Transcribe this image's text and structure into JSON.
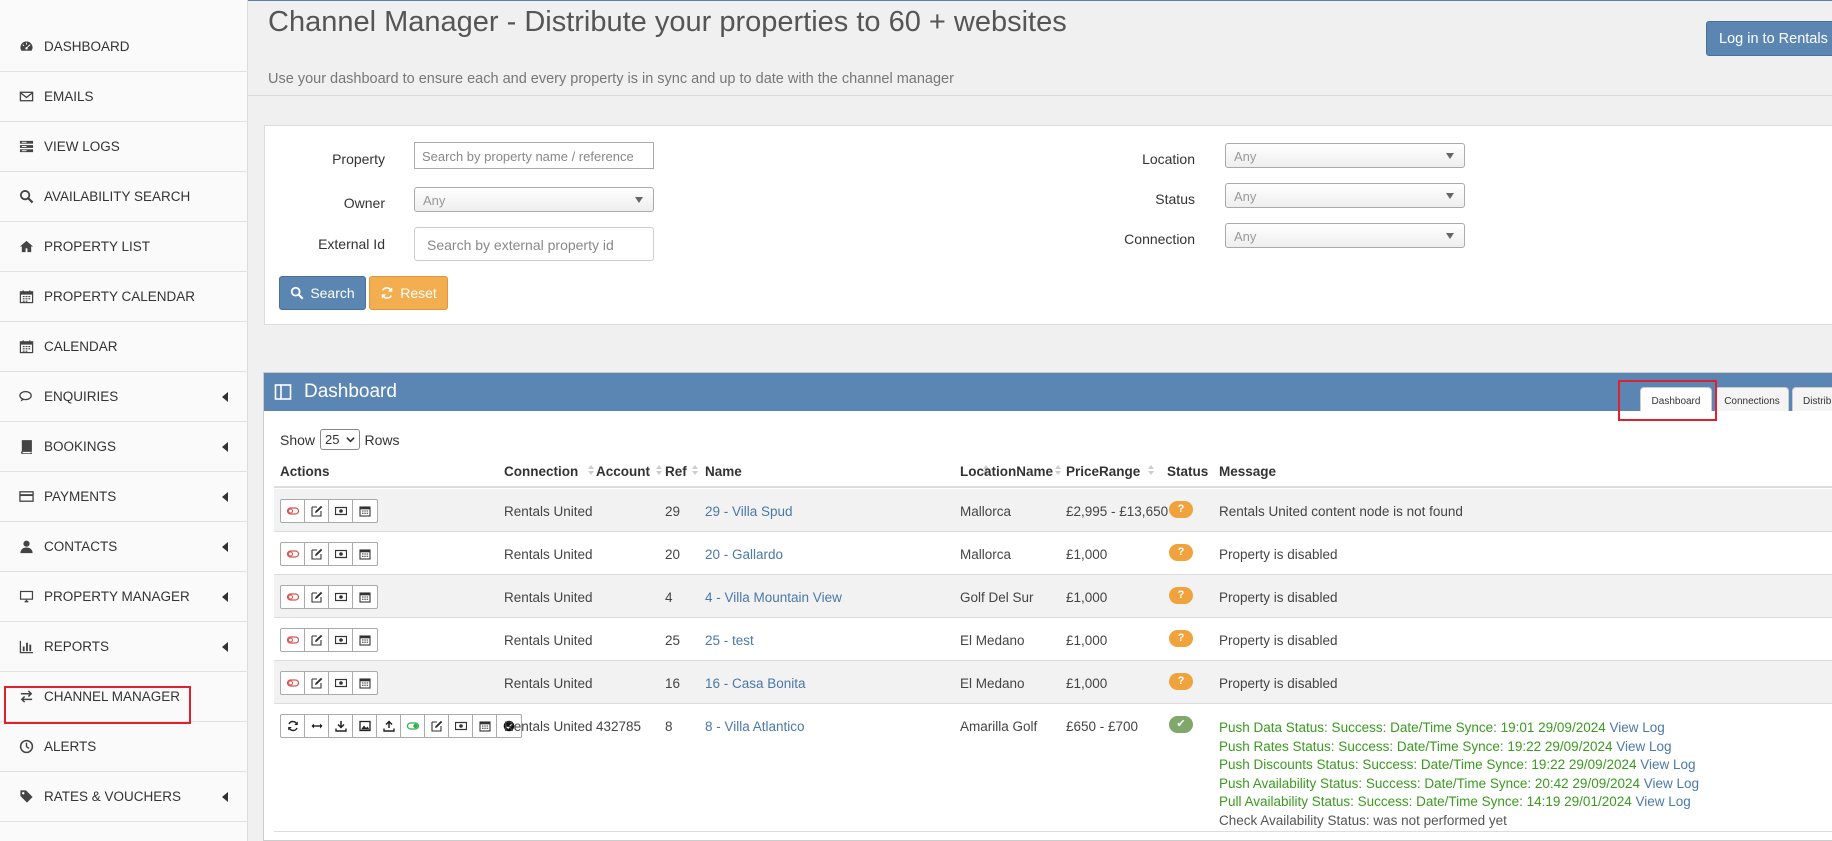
{
  "sidebar": {
    "items": [
      {
        "label": "DASHBOARD",
        "icon": "dashboard-icon"
      },
      {
        "label": "EMAILS",
        "icon": "envelope-icon"
      },
      {
        "label": "VIEW LOGS",
        "icon": "logs-icon"
      },
      {
        "label": "AVAILABILITY SEARCH",
        "icon": "search-icon"
      },
      {
        "label": "PROPERTY LIST",
        "icon": "home-icon"
      },
      {
        "label": "PROPERTY CALENDAR",
        "icon": "calendar-icon"
      },
      {
        "label": "CALENDAR",
        "icon": "calendar-icon"
      },
      {
        "label": "ENQUIRIES",
        "icon": "comments-icon",
        "has_submenu": true
      },
      {
        "label": "BOOKINGS",
        "icon": "book-icon",
        "has_submenu": true
      },
      {
        "label": "PAYMENTS",
        "icon": "credit-card-icon",
        "has_submenu": true
      },
      {
        "label": "CONTACTS",
        "icon": "user-icon",
        "has_submenu": true
      },
      {
        "label": "PROPERTY MANAGER",
        "icon": "desktop-icon",
        "has_submenu": true
      },
      {
        "label": "REPORTS",
        "icon": "bar-chart-icon",
        "has_submenu": true
      },
      {
        "label": "CHANNEL MANAGER",
        "icon": "exchange-icon",
        "highlighted": true
      },
      {
        "label": "ALERTS",
        "icon": "clock-icon"
      },
      {
        "label": "RATES & VOUCHERS",
        "icon": "tag-icon",
        "has_submenu": true
      }
    ]
  },
  "header": {
    "title": "Channel Manager - Distribute your properties to 60 + websites",
    "subtitle": "Use your dashboard to ensure each and every property is in sync and up to date with the channel manager",
    "login_button": "Log in to Rentals United"
  },
  "filters": {
    "property_label": "Property",
    "property_placeholder": "Search by property name / reference",
    "owner_label": "Owner",
    "owner_value": "Any",
    "external_id_label": "External Id",
    "external_id_placeholder": "Search by external property id",
    "location_label": "Location",
    "location_value": "Any",
    "status_label": "Status",
    "status_value": "Any",
    "connection_label": "Connection",
    "connection_value": "Any",
    "search_button": "Search",
    "reset_button": "Reset"
  },
  "dashboard": {
    "title": "Dashboard",
    "tabs": [
      {
        "label": "Dashboard",
        "active": true
      },
      {
        "label": "Connections",
        "active": false
      },
      {
        "label": "Distribution",
        "active": false
      }
    ],
    "show_label": "Show",
    "rows_value": "25",
    "rows_label": "Rows",
    "columns": [
      "Actions",
      "Connection",
      "Account",
      "Ref",
      "Name",
      "LocationName",
      "PriceRange",
      "Status",
      "Message"
    ],
    "rows": [
      {
        "connection": "Rentals United",
        "account": "",
        "ref": "29",
        "name": "29 - Villa Spud",
        "location": "Mallorca",
        "price": "£2,995 - £13,650",
        "status": "?",
        "message": "Rentals United content node is not found"
      },
      {
        "connection": "Rentals United",
        "account": "",
        "ref": "20",
        "name": "20 - Gallardo",
        "location": "Mallorca",
        "price": "£1,000",
        "status": "?",
        "message": "Property is disabled"
      },
      {
        "connection": "Rentals United",
        "account": "",
        "ref": "4",
        "name": "4 - Villa Mountain View",
        "location": "Golf Del Sur",
        "price": "£1,000",
        "status": "?",
        "message": "Property is disabled"
      },
      {
        "connection": "Rentals United",
        "account": "",
        "ref": "25",
        "name": "25 - test",
        "location": "El Medano",
        "price": "£1,000",
        "status": "?",
        "message": "Property is disabled"
      },
      {
        "connection": "Rentals United",
        "account": "",
        "ref": "16",
        "name": "16 - Casa Bonita",
        "location": "El Medano",
        "price": "£1,000",
        "status": "?",
        "message": "Property is disabled"
      }
    ],
    "connected_row": {
      "connection": "Rentals United",
      "account": "432785",
      "ref": "8",
      "name": "8 - Villa Atlantico",
      "location": "Amarilla Golf",
      "price": "£650 - £700",
      "status": "✔",
      "messages": [
        {
          "text": "Push Data Status: Success: Date/Time Synce: 19:01 29/09/2024",
          "link": "View Log"
        },
        {
          "text": "Push Rates Status: Success: Date/Time Synce: 19:22 29/09/2024",
          "link": "View Log"
        },
        {
          "text": "Push Discounts Status: Success: Date/Time Synce: 19:22 29/09/2024",
          "link": "View Log"
        },
        {
          "text": "Push Availability Status: Success: Date/Time Synce: 20:42 29/09/2024",
          "link": "View Log"
        },
        {
          "text": "Pull Availability Status: Success: Date/Time Synce: 14:19 29/01/2024",
          "link": "View Log"
        },
        {
          "text": "Check Availability Status: was not performed yet",
          "link": ""
        }
      ]
    }
  },
  "colors": {
    "primary": "#5b86b3",
    "warning": "#f0a23c",
    "success": "#7fa86a",
    "highlight": "#e0202c",
    "link": "#4a78a8",
    "success_text": "#3a9a1e"
  }
}
